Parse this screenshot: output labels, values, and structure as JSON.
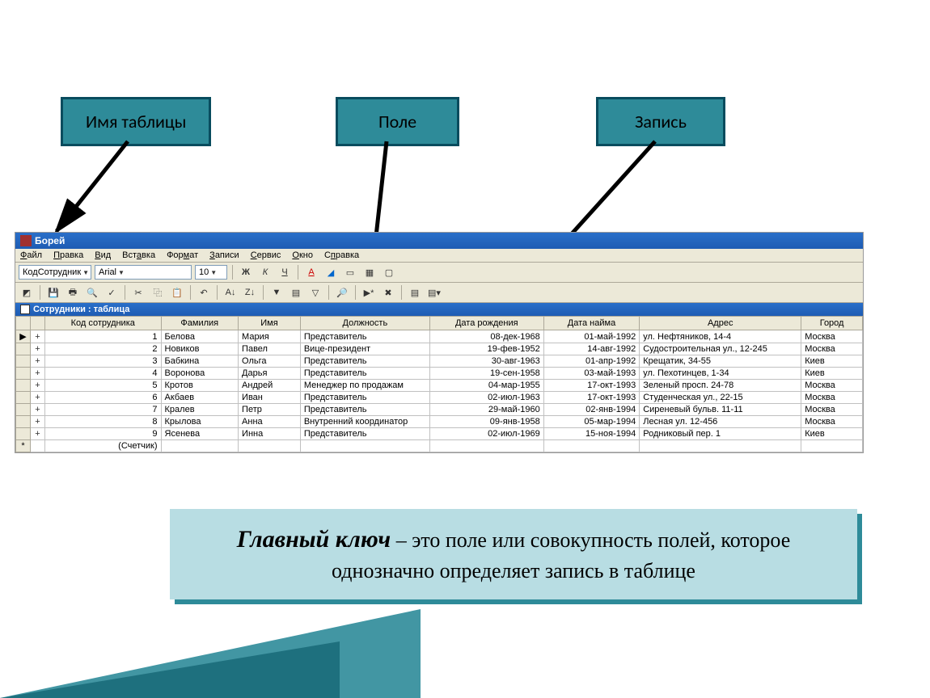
{
  "labels": {
    "table_name": "Имя таблицы",
    "field": "Поле",
    "record": "Запись"
  },
  "app": {
    "title": "Борей",
    "menu": [
      "Файл",
      "Правка",
      "Вид",
      "Вставка",
      "Формат",
      "Записи",
      "Сервис",
      "Окно",
      "Справка"
    ],
    "field_selector": "КодСотрудник",
    "font_name": "Arial",
    "font_size": "10",
    "subwindow_title": "Сотрудники : таблица"
  },
  "columns": [
    "Код сотрудника",
    "Фамилия",
    "Имя",
    "Должность",
    "Дата рождения",
    "Дата найма",
    "Адрес",
    "Город"
  ],
  "rows": [
    {
      "id": "1",
      "last": "Белова",
      "first": "Мария",
      "role": "Представитель",
      "dob": "08-дек-1968",
      "hire": "01-май-1992",
      "addr": "ул. Нефтяников, 14-4",
      "city": "Москва"
    },
    {
      "id": "2",
      "last": "Новиков",
      "first": "Павел",
      "role": "Вице-президент",
      "dob": "19-фев-1952",
      "hire": "14-авг-1992",
      "addr": "Судостроительная ул., 12-245",
      "city": "Москва"
    },
    {
      "id": "3",
      "last": "Бабкина",
      "first": "Ольга",
      "role": "Представитель",
      "dob": "30-авг-1963",
      "hire": "01-апр-1992",
      "addr": "Крещатик, 34-55",
      "city": "Киев"
    },
    {
      "id": "4",
      "last": "Воронова",
      "first": "Дарья",
      "role": "Представитель",
      "dob": "19-сен-1958",
      "hire": "03-май-1993",
      "addr": "ул. Пехотинцев, 1-34",
      "city": "Киев"
    },
    {
      "id": "5",
      "last": "Кротов",
      "first": "Андрей",
      "role": "Менеджер по продажам",
      "dob": "04-мар-1955",
      "hire": "17-окт-1993",
      "addr": "Зеленый просп. 24-78",
      "city": "Москва"
    },
    {
      "id": "6",
      "last": "Акбаев",
      "first": "Иван",
      "role": "Представитель",
      "dob": "02-июл-1963",
      "hire": "17-окт-1993",
      "addr": "Студенческая ул., 22-15",
      "city": "Москва"
    },
    {
      "id": "7",
      "last": "Кралев",
      "first": "Петр",
      "role": "Представитель",
      "dob": "29-май-1960",
      "hire": "02-янв-1994",
      "addr": "Сиреневый бульв. 11-11",
      "city": "Москва"
    },
    {
      "id": "8",
      "last": "Крылова",
      "first": "Анна",
      "role": "Внутренний координатор",
      "dob": "09-янв-1958",
      "hire": "05-мар-1994",
      "addr": "Лесная ул. 12-456",
      "city": "Москва"
    },
    {
      "id": "9",
      "last": "Ясенева",
      "first": "Инна",
      "role": "Представитель",
      "dob": "02-июл-1969",
      "hire": "15-ноя-1994",
      "addr": "Родниковый пер. 1",
      "city": "Киев"
    }
  ],
  "new_row_placeholder": "(Счетчик)",
  "definition": {
    "term": "Главный ключ",
    "text": " – это поле или совокупность полей, которое однозначно определяет запись в таблице"
  }
}
